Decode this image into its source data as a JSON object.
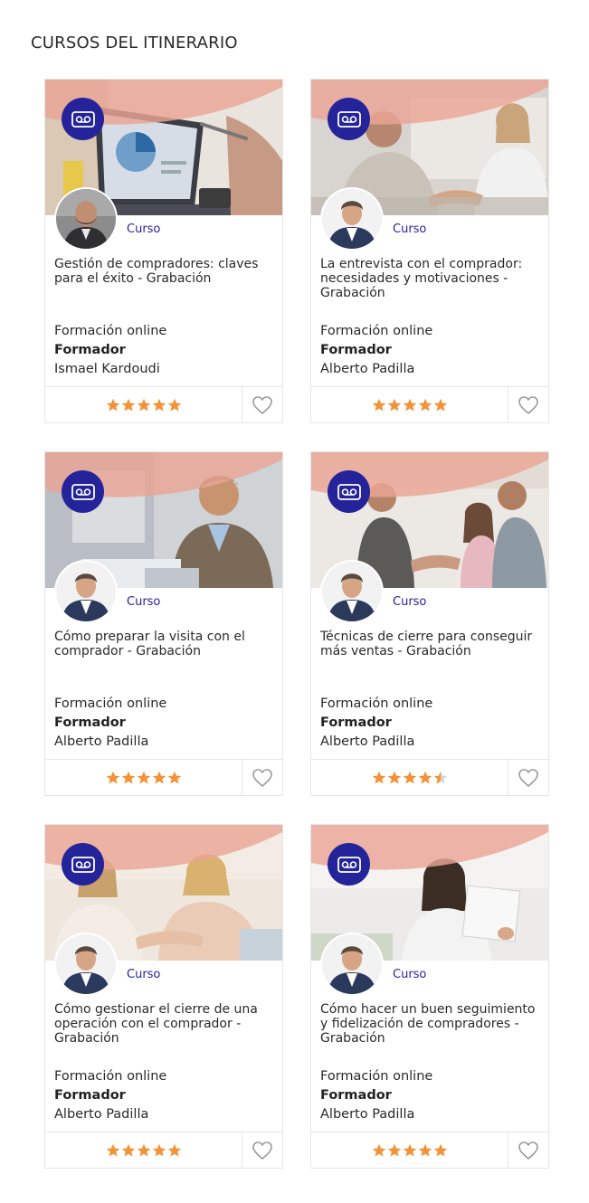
{
  "section": {
    "title": "CURSOS DEL ITINERARIO"
  },
  "colors": {
    "accent": "#24239a",
    "star": "#f39237",
    "star_empty": "#d6d6d6",
    "heart": "#9a9a9a",
    "banner": "#eaa595"
  },
  "courses": [
    {
      "type": "Curso",
      "title": "Gestión de compradores: claves para el éxito - Grabación",
      "modality": "Formación online",
      "trainer_label": "Formador",
      "trainer": "Ismael Kardoudi",
      "rating": 5,
      "icon": "recording-icon",
      "scene": "laptop-chart"
    },
    {
      "type": "Curso",
      "title": "La entrevista con el comprador: necesidades y motivaciones - Grabación",
      "modality": "Formación online",
      "trainer_label": "Formador",
      "trainer": "Alberto Padilla",
      "rating": 5,
      "icon": "recording-icon",
      "scene": "meeting-handshake"
    },
    {
      "type": "Curso",
      "title": "Cómo preparar la visita con el comprador - Grabación",
      "modality": "Formación online",
      "trainer_label": "Formador",
      "trainer": "Alberto Padilla",
      "rating": 5,
      "icon": "recording-icon",
      "scene": "man-laptop"
    },
    {
      "type": "Curso",
      "title": "Técnicas de cierre para conseguir más ventas - Grabación",
      "modality": "Formación online",
      "trainer_label": "Formador",
      "trainer": "Alberto Padilla",
      "rating": 4.5,
      "icon": "recording-icon",
      "scene": "group-handshake"
    },
    {
      "type": "Curso",
      "title": "Cómo gestionar el cierre de una operación con el comprador - Grabación",
      "modality": "Formación online",
      "trainer_label": "Formador",
      "trainer": "Alberto Padilla",
      "rating": 5,
      "icon": "recording-icon",
      "scene": "women-handshake"
    },
    {
      "type": "Curso",
      "title": "Cómo hacer un buen seguimiento y fidelización de compradores - Grabación",
      "modality": "Formación online",
      "trainer_label": "Formador",
      "trainer": "Alberto Padilla",
      "rating": 5,
      "icon": "recording-icon",
      "scene": "woman-document"
    }
  ]
}
